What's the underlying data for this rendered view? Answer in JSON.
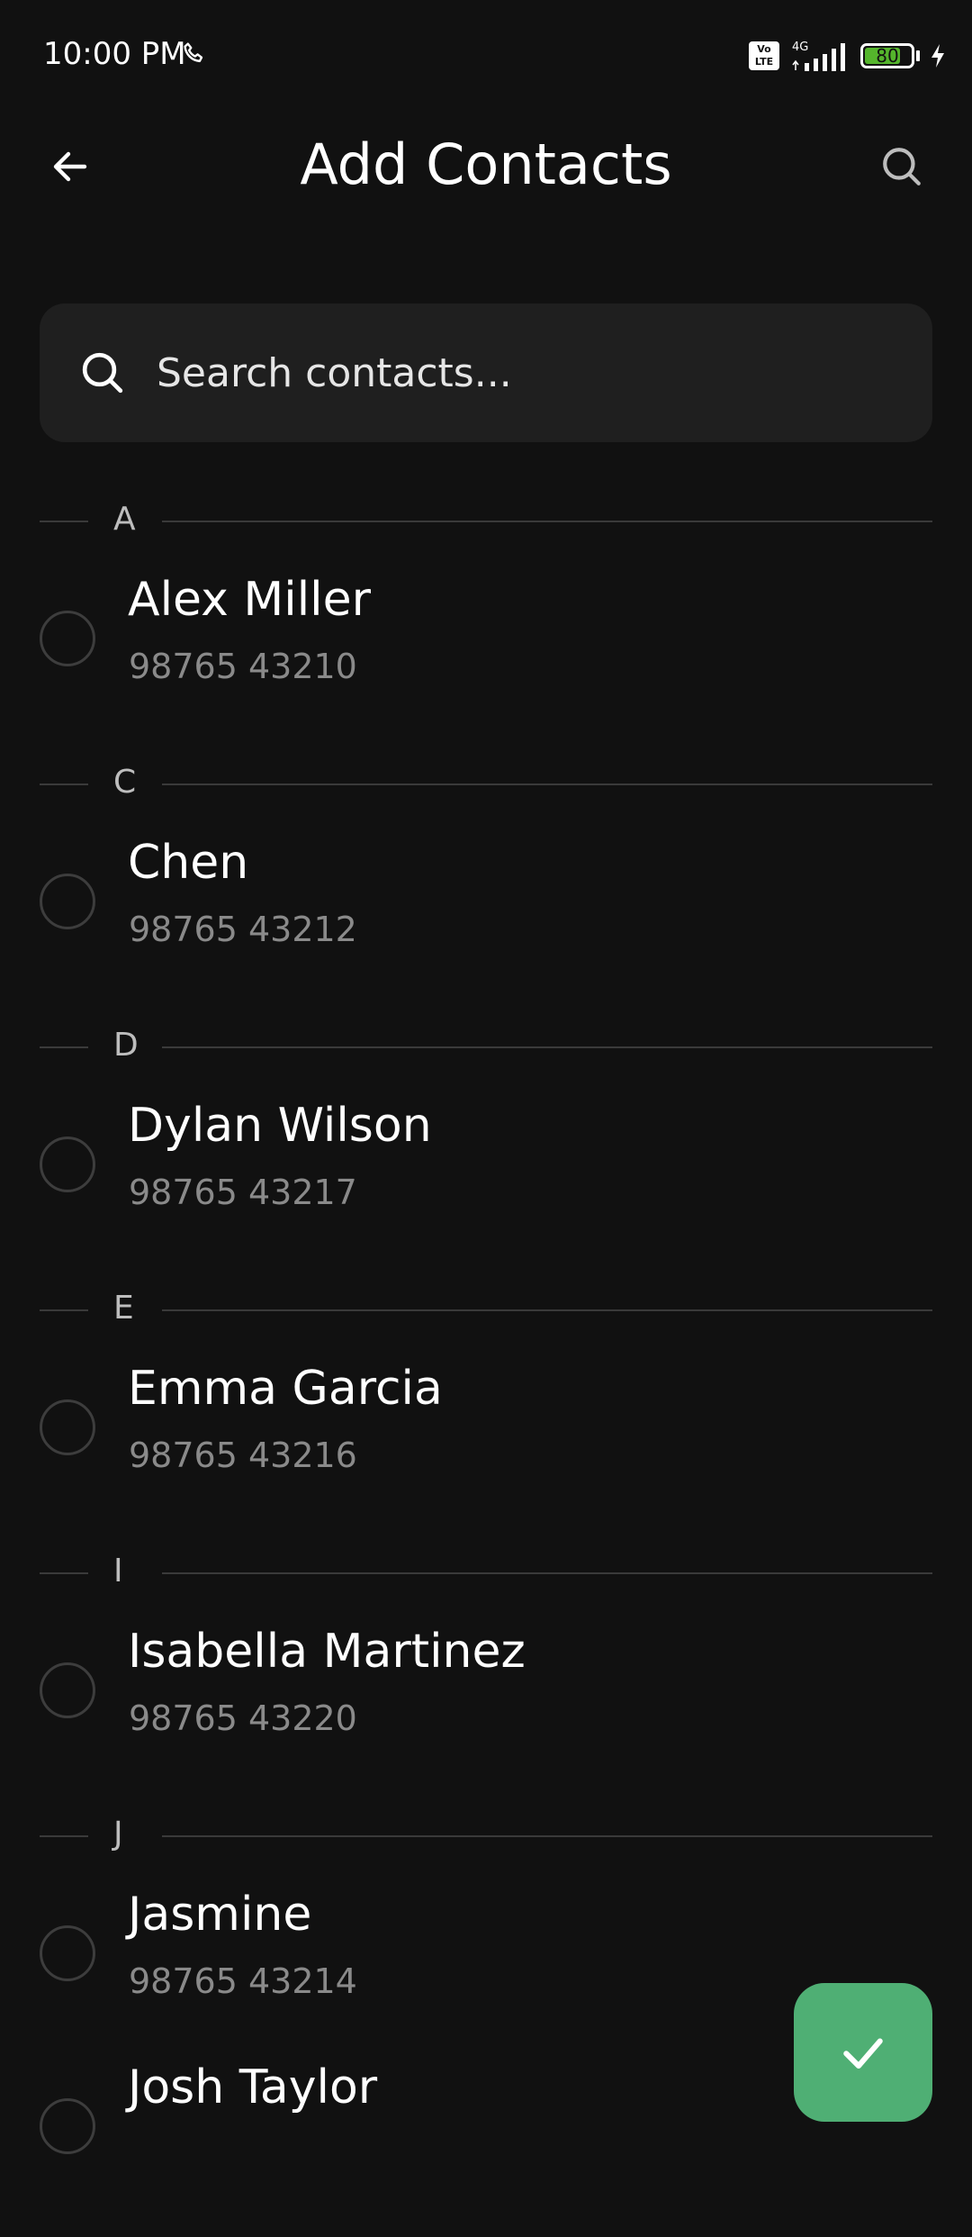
{
  "status_bar": {
    "time": "10:00 PM",
    "network_type": "4G",
    "volte_top": "Vo",
    "volte_bottom": "LTE",
    "battery_level": "80",
    "battery_fraction": 0.8,
    "battery_color": "#55b52c"
  },
  "app_bar": {
    "title": "Add Contacts",
    "back_icon": "back-arrow-icon",
    "search_icon": "search-icon"
  },
  "search": {
    "placeholder": "Search contacts..."
  },
  "contacts": {
    "sections": [
      {
        "letter": "A",
        "items": [
          {
            "name": "Alex Miller",
            "phone": "98765 43210"
          }
        ]
      },
      {
        "letter": "C",
        "items": [
          {
            "name": "Chen",
            "phone": "98765 43212"
          }
        ]
      },
      {
        "letter": "D",
        "items": [
          {
            "name": "Dylan Wilson",
            "phone": "98765 43217"
          }
        ]
      },
      {
        "letter": "E",
        "items": [
          {
            "name": "Emma Garcia",
            "phone": "98765 43216"
          }
        ]
      },
      {
        "letter": "I",
        "items": [
          {
            "name": "Isabella Martinez",
            "phone": "98765 43220"
          }
        ]
      },
      {
        "letter": "J",
        "items": [
          {
            "name": "Jasmine",
            "phone": "98765 43214"
          },
          {
            "name": "Josh Taylor",
            "phone": ""
          }
        ]
      }
    ]
  },
  "fab": {
    "icon": "checkmark-icon",
    "color": "#4faf74"
  }
}
